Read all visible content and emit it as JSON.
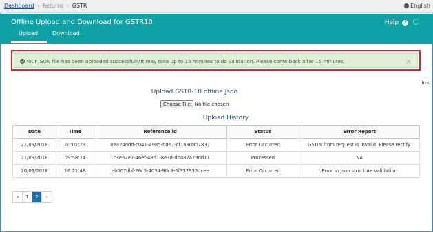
{
  "breadcrumb": {
    "items": [
      "Dashboard",
      "Returns",
      "GSTR"
    ],
    "separator": "›"
  },
  "language": "English",
  "header": {
    "title": "Offline Upload and Download for GSTR10",
    "help_label": "Help",
    "tabs": [
      "Upload",
      "Download"
    ],
    "active_tab": "Upload"
  },
  "alert": {
    "message": "Your JSON file has been uploaded successfully.It may take up to 15 minutes to do validation. Please come back after 15 minutes.",
    "close": "×"
  },
  "right_cut_text": "In c",
  "upload": {
    "title": "Upload GSTR-10 offline Json",
    "choose_file_label": "Choose File",
    "file_status": "No file chosen"
  },
  "history": {
    "title": "Upload History",
    "columns": [
      "Date",
      "Time",
      "Reference id",
      "Status",
      "Error Report"
    ],
    "rows": [
      [
        "21/09/2018",
        "10:01:23",
        "0ea24ddd-c041-4985-bd67-cf1a309b7832",
        "Error Occurred",
        "GSTIN from request is invalid. Please rectify."
      ],
      [
        "21/09/2018",
        "09:58:24",
        "1c3e52e7-46ef-4861-8e3d-dba82a79dd11",
        "Processed",
        "NA"
      ],
      [
        "20/09/2018",
        "16:21:48",
        "eb007dbf-26c5-4034-90c3-5f337935dcee",
        "Error Occurred",
        "Error in Json structure validation"
      ]
    ]
  },
  "pagination": {
    "prev": "«",
    "pages": [
      "1",
      "2"
    ],
    "active_page": "2",
    "next": "»"
  },
  "colors": {
    "header_bg": "#0ea1a6",
    "alert_bg": "#dff0d8",
    "highlight_border": "#e02323",
    "link": "#1a4f8c"
  }
}
